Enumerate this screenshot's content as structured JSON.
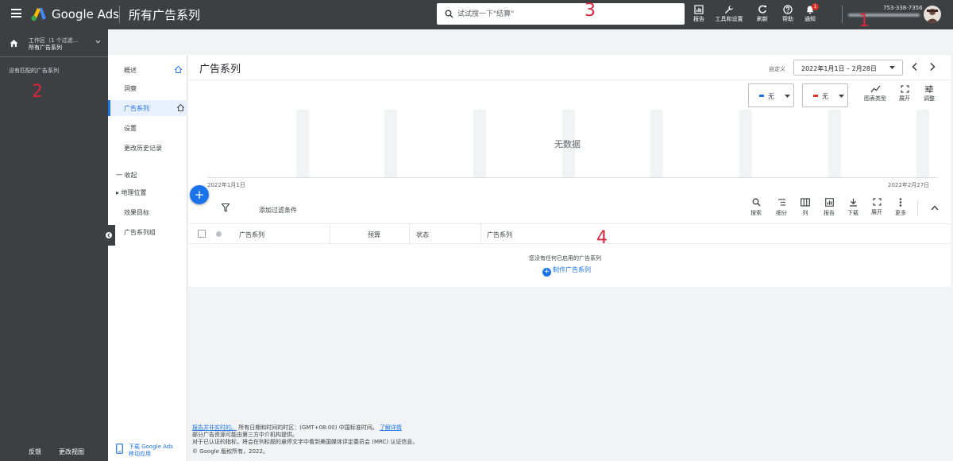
{
  "header": {
    "brand": "Google Ads",
    "page_title": "所有广告系列",
    "search_placeholder": "试试搜一下\"结算\"",
    "tools": [
      {
        "label": "报告"
      },
      {
        "label": "工具和设置"
      },
      {
        "label": "刷新"
      },
      {
        "label": "帮助"
      },
      {
        "label": "通知"
      }
    ],
    "notification_count": "1",
    "account_id": "753-338-7356"
  },
  "workspace": {
    "line1": "工作区（1 个过滤...",
    "line2": "所有广告系列"
  },
  "left_panel": {
    "no_match": "没有匹配的广告系列",
    "footer_feedback": "反馈",
    "footer_change_view": "更改视图"
  },
  "nav": {
    "items": [
      {
        "label": "概述"
      },
      {
        "label": "洞察"
      },
      {
        "label": "广告系列"
      },
      {
        "label": "设置"
      },
      {
        "label": "更改历史记录"
      }
    ],
    "collapse": "一 收起",
    "more_items": [
      {
        "label": "▸ 地理位置"
      },
      {
        "label": "效果目标"
      },
      {
        "label": "广告系列组"
      }
    ],
    "app_line1": "下载 Google Ads",
    "app_line2": "移动应用"
  },
  "main": {
    "title": "广告系列",
    "date_custom_label": "自定义",
    "date_range": "2022年1月1日 – 2月28日",
    "metric1": "无",
    "metric2": "无",
    "chart_tools": [
      {
        "label": "图表类型"
      },
      {
        "label": "展开"
      },
      {
        "label": "调整"
      }
    ],
    "no_data": "无数据",
    "axis_start": "2022年1月1日",
    "axis_end": "2022年2月27日",
    "filter_label": "添加过滤条件",
    "table_tools": [
      {
        "label": "搜索"
      },
      {
        "label": "细分"
      },
      {
        "label": "列"
      },
      {
        "label": "报告"
      },
      {
        "label": "下载"
      },
      {
        "label": "展开"
      },
      {
        "label": "更多"
      }
    ],
    "columns": [
      "广告系列",
      "预算",
      "状态",
      "广告系列"
    ],
    "empty_message": "您没有任何已启用的广告系列",
    "create_label": "制作广告系列"
  },
  "footer": {
    "link1": "报告并非实时的。",
    "line1_rest": "所有日期和时间的时区：(GMT+08:00) 中国标准时间。",
    "link2": "了解详情",
    "line2": "部分广告资源可能由第三方中介机构提供。",
    "line3": "对于已认证的指标，将会在列标题的悬停文字中看到美国媒体评定委员会 (MRC) 认证信息。",
    "line4": "© Google 版权所有，2022。"
  },
  "annotations": [
    "1",
    "2",
    "3",
    "4"
  ],
  "colors": {
    "header_bg": "#3c4043",
    "accent": "#1a73e8",
    "annotation": "#d7263d",
    "metric1": "#1a73e8",
    "metric2": "#d93025"
  }
}
